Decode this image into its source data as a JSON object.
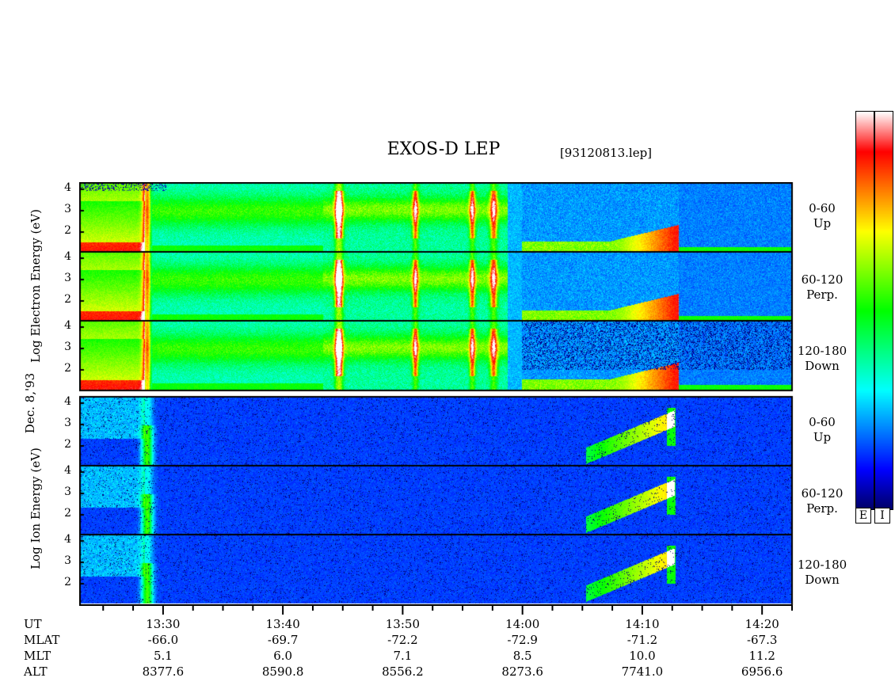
{
  "header": {
    "title": "EXOS-D LEP",
    "file_id": "[93120813.lep]"
  },
  "left_labels": {
    "date": "Dec. 8,'93",
    "electron_axis": "Log  Electron  Energy  (eV)",
    "ion_axis": "Log  Ion  Energy  (eV)"
  },
  "colorbars": {
    "electron_label": "E",
    "ion_label": "I",
    "stops": [
      "#000066",
      "#0000ff",
      "#0080ff",
      "#00ffff",
      "#00ff80",
      "#00ff00",
      "#80ff00",
      "#ffff00",
      "#ff8000",
      "#ff0000",
      "#ffffff"
    ]
  },
  "chart_data": {
    "type": "heatmap",
    "title": "EXOS-D LEP",
    "x_axis": {
      "time_start": "13:23:00",
      "time_end": "14:22:30",
      "major_ticks": [
        "13:30",
        "13:40",
        "13:50",
        "14:00",
        "14:10",
        "14:20"
      ],
      "rows": [
        {
          "label": "UT",
          "values": [
            "13:30",
            "13:40",
            "13:50",
            "14:00",
            "14:10",
            "14:20"
          ]
        },
        {
          "label": "MLAT",
          "values": [
            "-66.0",
            "-69.7",
            "-72.2",
            "-72.9",
            "-71.2",
            "-67.3"
          ]
        },
        {
          "label": "MLT",
          "values": [
            "5.1",
            "6.0",
            "7.1",
            "8.5",
            "10.0",
            "11.2"
          ]
        },
        {
          "label": "ALT",
          "values": [
            "8377.6",
            "8590.8",
            "8556.2",
            "8273.6",
            "7741.0",
            "6956.6"
          ]
        }
      ]
    },
    "y_ticks": [
      "4",
      "3",
      "2"
    ],
    "panels": [
      {
        "species": "Electron",
        "pitch": "0-60",
        "dir": "Up"
      },
      {
        "species": "Electron",
        "pitch": "60-120",
        "dir": "Perp."
      },
      {
        "species": "Electron",
        "pitch": "120-180",
        "dir": "Down"
      },
      {
        "species": "Ion",
        "pitch": "0-60",
        "dir": "Up"
      },
      {
        "species": "Ion",
        "pitch": "60-120",
        "dir": "Perp."
      },
      {
        "species": "Ion",
        "pitch": "120-180",
        "dir": "Down"
      }
    ]
  }
}
